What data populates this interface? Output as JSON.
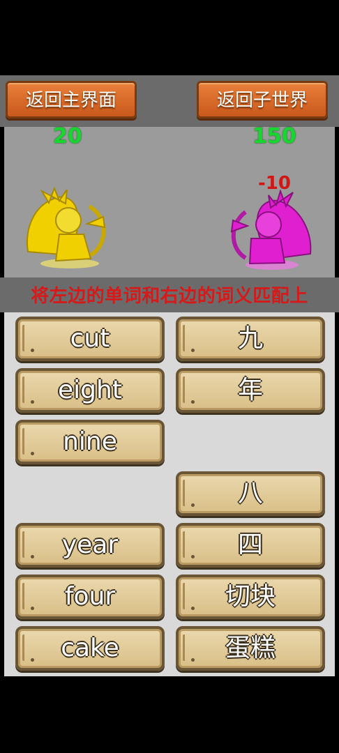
{
  "header": {
    "back_main_label": "返回主界面",
    "back_world_label": "返回子世界"
  },
  "battle": {
    "player_score": "20",
    "enemy_score": "150",
    "damage_text": "-10",
    "player_color": "#f0d000",
    "enemy_color": "#e020d0"
  },
  "instruction": "将左边的单词和右边的词义匹配上",
  "words_left": [
    "cut",
    "eight",
    "nine",
    "year",
    "four",
    "cake"
  ],
  "meanings_right": [
    "九",
    "年",
    "八",
    "四",
    "切块",
    "蛋糕"
  ]
}
